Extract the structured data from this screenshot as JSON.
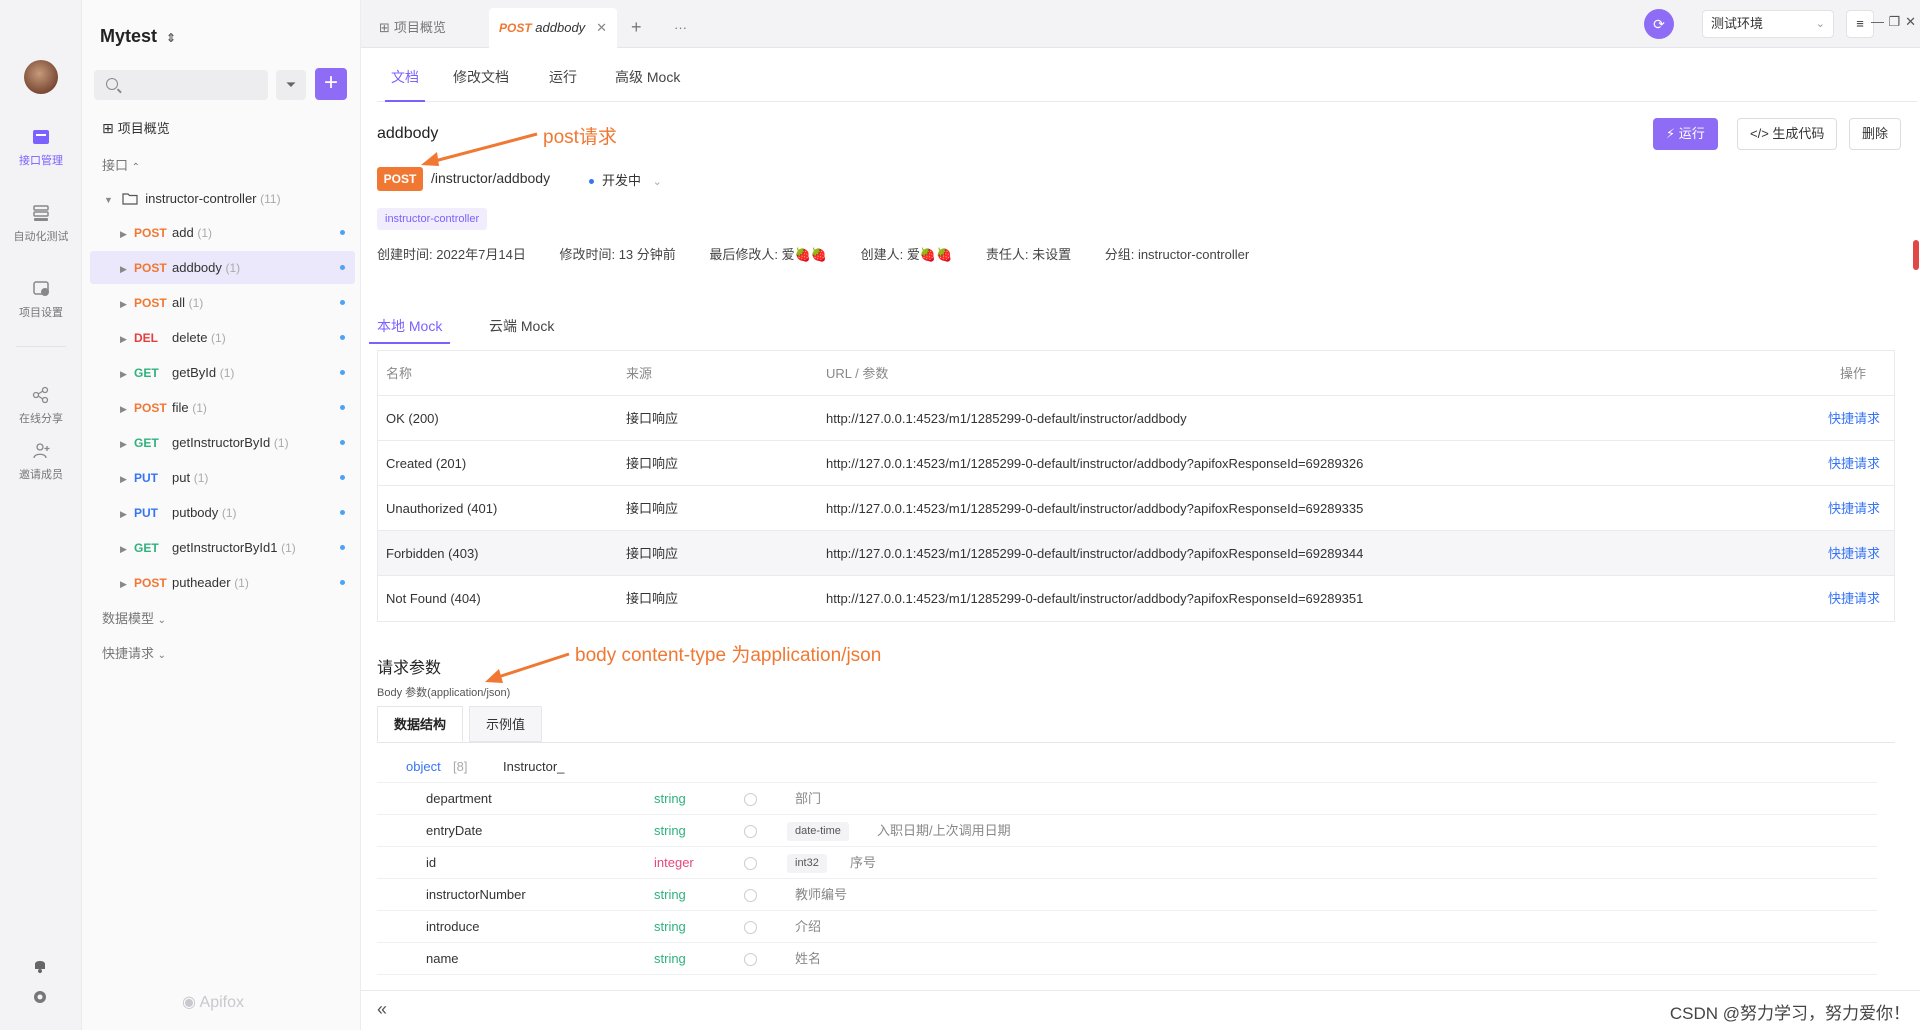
{
  "rail": {
    "items": [
      {
        "label": "接口管理",
        "icon": "api-icon",
        "active": true
      },
      {
        "label": "自动化测试",
        "icon": "automation-icon"
      },
      {
        "label": "项目设置",
        "icon": "settings-icon"
      },
      {
        "label": "在线分享",
        "icon": "share-icon"
      },
      {
        "label": "邀请成员",
        "icon": "invite-icon"
      }
    ]
  },
  "sidebar": {
    "project_name": "Mytest",
    "project_chevron": "⌃",
    "overview_label": "项目概览",
    "api_section": "接口",
    "folder_name": "instructor-controller",
    "folder_count": "(11)",
    "endpoints": [
      {
        "method": "POST",
        "name": "add",
        "count": "(1)"
      },
      {
        "method": "POST",
        "name": "addbody",
        "count": "(1)",
        "selected": true
      },
      {
        "method": "POST",
        "name": "all",
        "count": "(1)"
      },
      {
        "method": "DEL",
        "name": "delete",
        "count": "(1)"
      },
      {
        "method": "GET",
        "name": "getById",
        "count": "(1)"
      },
      {
        "method": "POST",
        "name": "file",
        "count": "(1)"
      },
      {
        "method": "GET",
        "name": "getInstructorById",
        "count": "(1)"
      },
      {
        "method": "PUT",
        "name": "put",
        "count": "(1)"
      },
      {
        "method": "PUT",
        "name": "putbody",
        "count": "(1)"
      },
      {
        "method": "GET",
        "name": "getInstructorById1",
        "count": "(1)"
      },
      {
        "method": "POST",
        "name": "putheader",
        "count": "(1)"
      }
    ],
    "data_models": "数据模型",
    "quick_requests": "快捷请求",
    "brand": "Apifox"
  },
  "tabs": {
    "overview": "项目概览",
    "active_method": "POST",
    "active_title": "addbody",
    "plus": "+",
    "more": "···"
  },
  "topbar": {
    "env": "测试环境"
  },
  "subtabs": [
    "文档",
    "修改文档",
    "运行",
    "高级 Mock"
  ],
  "doc": {
    "title": "addbody",
    "method": "POST",
    "path": "/instructor/addbody",
    "status": "开发中",
    "folder_tag": "instructor-controller",
    "meta": [
      "创建时间: 2022年7月14日",
      "修改时间: 13 分钟前",
      "最后修改人: 爱🍓🍓",
      "创建人: 爱🍓🍓",
      "责任人: 未设置",
      "分组: instructor-controller"
    ],
    "buttons": {
      "run": "⚡ 运行",
      "gen": "</> 生成代码",
      "del": "删除"
    }
  },
  "annotations": {
    "post": "post请求",
    "body": "body content-type 为application/json",
    "color": "#f07833"
  },
  "mock": {
    "tabs": [
      "本地 Mock",
      "云端 Mock"
    ],
    "headers": [
      "名称",
      "来源",
      "URL / 参数",
      "操作"
    ],
    "rows": [
      {
        "name": "OK (200)",
        "source": "接口响应",
        "url": "http://127.0.0.1:4523/m1/1285299-0-default/instructor/addbody",
        "action": "快捷请求"
      },
      {
        "name": "Created (201)",
        "source": "接口响应",
        "url": "http://127.0.0.1:4523/m1/1285299-0-default/instructor/addbody?apifoxResponseId=69289326",
        "action": "快捷请求"
      },
      {
        "name": "Unauthorized (401)",
        "source": "接口响应",
        "url": "http://127.0.0.1:4523/m1/1285299-0-default/instructor/addbody?apifoxResponseId=69289335",
        "action": "快捷请求"
      },
      {
        "name": "Forbidden (403)",
        "source": "接口响应",
        "url": "http://127.0.0.1:4523/m1/1285299-0-default/instructor/addbody?apifoxResponseId=69289344",
        "action": "快捷请求"
      },
      {
        "name": "Not Found (404)",
        "source": "接口响应",
        "url": "http://127.0.0.1:4523/m1/1285299-0-default/instructor/addbody?apifoxResponseId=69289351",
        "action": "快捷请求"
      }
    ]
  },
  "request": {
    "heading": "请求参数",
    "body_label": "Body 参数(application/json)",
    "schema_tabs": [
      "数据结构",
      "示例值"
    ],
    "object_type": "object",
    "object_count": "[8]",
    "object_name": "Instructor_",
    "fields": [
      {
        "name": "department",
        "type": "string",
        "format": "",
        "desc": "部门"
      },
      {
        "name": "entryDate",
        "type": "string",
        "format": "date-time",
        "desc": "入职日期/上次调用日期"
      },
      {
        "name": "id",
        "type": "integer",
        "format": "int32",
        "desc": "序号"
      },
      {
        "name": "instructorNumber",
        "type": "string",
        "format": "",
        "desc": "教师编号"
      },
      {
        "name": "introduce",
        "type": "string",
        "format": "",
        "desc": "介绍"
      },
      {
        "name": "name",
        "type": "string",
        "format": "",
        "desc": "姓名"
      }
    ]
  },
  "footer": {
    "collapse": "«",
    "watermark": "CSDN @努力学习，努力爱你！"
  }
}
